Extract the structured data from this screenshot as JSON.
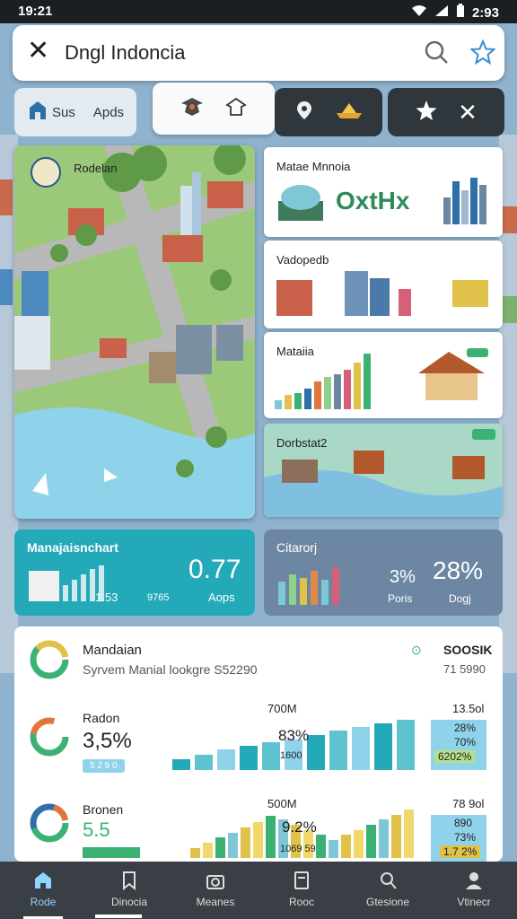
{
  "status": {
    "time": "19:21",
    "battery": "2:93"
  },
  "search": {
    "query": "Dngl Indoncia"
  },
  "chips": {
    "first": [
      "Sus",
      "Apds"
    ]
  },
  "map": {
    "label": "Rodelan"
  },
  "cards": [
    {
      "title": "Matae Mnnoia",
      "headline": "OxtHx"
    },
    {
      "title": "Vadopedb"
    },
    {
      "title": "Mataiia",
      "values": [
        4,
        6,
        7,
        9,
        12,
        14,
        15,
        17,
        20,
        24
      ]
    },
    {
      "title": "Dorbstat2"
    }
  ],
  "tiles": {
    "left": {
      "title": "Manajaisnchart",
      "value": "0.77",
      "sub_a": "1.53",
      "sub_b": "9765",
      "label": "Aops"
    },
    "right": {
      "title": "Citarorj",
      "pct_a": "3%",
      "pct_b": "28%",
      "label_a": "Poris",
      "label_b": "Dogj"
    }
  },
  "panel": {
    "header": {
      "title": "Mandaian",
      "subtitle": "Syrvem Manial lookgre  S52290",
      "right_top": "SOOSIK",
      "right_sub": "71 5990"
    },
    "rows": [
      {
        "name": "Radon",
        "value": "3,5%",
        "chip": "5 2 9 0",
        "col_left": "700M",
        "col_right": "13.5ol",
        "mid_a": "83%",
        "mid_b": "1600",
        "side": [
          "28%",
          "70%",
          "6202%"
        ],
        "values": [
          12,
          16,
          22,
          26,
          30,
          33,
          38,
          42,
          46,
          50,
          54
        ]
      },
      {
        "name": "Bronen",
        "value": "5.5",
        "chip": "",
        "col_left": "500M",
        "col_right": "78 9ol",
        "mid_a": "9.2%",
        "mid_b": "1069 59",
        "side": [
          "890",
          "73%",
          "1.7 2%"
        ],
        "values": [
          8,
          12,
          16,
          20,
          24,
          28,
          33,
          30,
          26,
          22,
          18,
          14,
          18,
          22,
          26,
          30,
          34,
          38
        ]
      }
    ]
  },
  "nav": [
    {
      "label": "Rode",
      "icon": "home-icon"
    },
    {
      "label": "Dinocia",
      "icon": "bookmark-icon"
    },
    {
      "label": "Meanes",
      "icon": "camera-icon"
    },
    {
      "label": "Rooc",
      "icon": "document-icon"
    },
    {
      "label": "Gtesione",
      "icon": "search-person-icon"
    },
    {
      "label": "Vtinecr",
      "icon": "profile-icon"
    }
  ],
  "colors": {
    "teal": "#23a9b8",
    "slate": "#6d87a3",
    "green": "#3bb273",
    "navbar": "#3a3f45"
  }
}
